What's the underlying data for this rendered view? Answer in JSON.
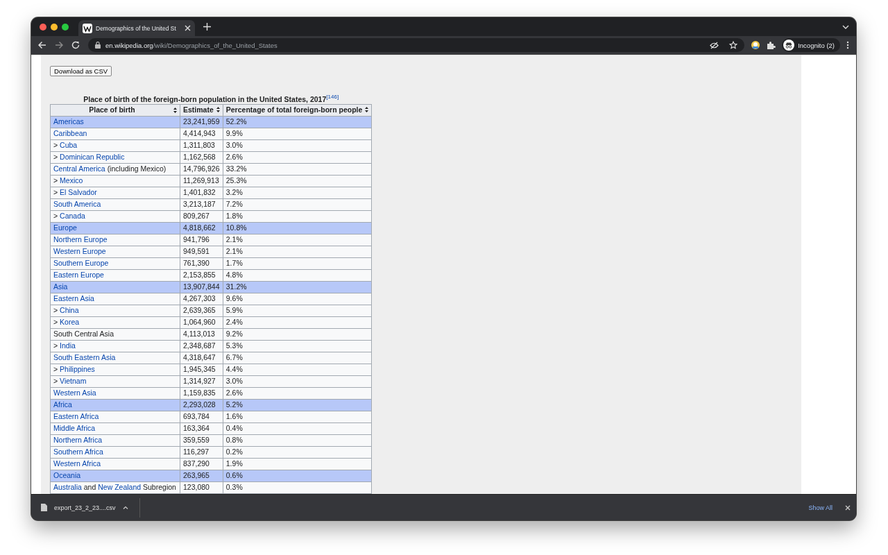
{
  "browser": {
    "tab": {
      "title": "Demographics of the United St",
      "selected": true
    },
    "address": {
      "domain": "en.wikipedia.org",
      "path": "/wiki/Demographics_of_the_United_States"
    },
    "profile": "Incognito (2)"
  },
  "page": {
    "download_button": "Download as CSV",
    "table": {
      "caption": "Place of birth of the foreign-born population in the United States, 2017",
      "caption_ref": "[146]",
      "columns": [
        "Place of birth",
        "Estimate",
        "Percentage of total foreign-born people"
      ],
      "rows": [
        {
          "place": [
            {
              "text": "Americas",
              "link": true
            }
          ],
          "estimate": "23,241,959",
          "percent": "52.2%",
          "highlighted": true
        },
        {
          "place": [
            {
              "text": "Caribbean",
              "link": true
            }
          ],
          "estimate": "4,414,943",
          "percent": "9.9%",
          "highlighted": false
        },
        {
          "place": [
            {
              "text": ">",
              "link": false
            },
            {
              "text": "Cuba",
              "link": true
            }
          ],
          "estimate": "1,311,803",
          "percent": "3.0%",
          "highlighted": false
        },
        {
          "place": [
            {
              "text": ">",
              "link": false
            },
            {
              "text": "Dominican Republic",
              "link": true
            }
          ],
          "estimate": "1,162,568",
          "percent": "2.6%",
          "highlighted": false
        },
        {
          "place": [
            {
              "text": "Central America",
              "link": true
            },
            {
              "text": "(including Mexico)",
              "link": false
            }
          ],
          "estimate": "14,796,926",
          "percent": "33.2%",
          "highlighted": false
        },
        {
          "place": [
            {
              "text": ">",
              "link": false
            },
            {
              "text": "Mexico",
              "link": true
            }
          ],
          "estimate": "11,269,913",
          "percent": "25.3%",
          "highlighted": false
        },
        {
          "place": [
            {
              "text": ">",
              "link": false
            },
            {
              "text": "El Salvador",
              "link": true
            }
          ],
          "estimate": "1,401,832",
          "percent": "3.2%",
          "highlighted": false
        },
        {
          "place": [
            {
              "text": "South America",
              "link": true
            }
          ],
          "estimate": "3,213,187",
          "percent": "7.2%",
          "highlighted": false
        },
        {
          "place": [
            {
              "text": ">",
              "link": false
            },
            {
              "text": "Canada",
              "link": true
            }
          ],
          "estimate": "809,267",
          "percent": "1.8%",
          "highlighted": false
        },
        {
          "place": [
            {
              "text": "Europe",
              "link": true
            }
          ],
          "estimate": "4,818,662",
          "percent": "10.8%",
          "highlighted": true
        },
        {
          "place": [
            {
              "text": "Northern Europe",
              "link": true
            }
          ],
          "estimate": "941,796",
          "percent": "2.1%",
          "highlighted": false
        },
        {
          "place": [
            {
              "text": "Western Europe",
              "link": true
            }
          ],
          "estimate": "949,591",
          "percent": "2.1%",
          "highlighted": false
        },
        {
          "place": [
            {
              "text": "Southern Europe",
              "link": true
            }
          ],
          "estimate": "761,390",
          "percent": "1.7%",
          "highlighted": false
        },
        {
          "place": [
            {
              "text": "Eastern Europe",
              "link": true
            }
          ],
          "estimate": "2,153,855",
          "percent": "4.8%",
          "highlighted": false
        },
        {
          "place": [
            {
              "text": "Asia",
              "link": true
            }
          ],
          "estimate": "13,907,844",
          "percent": "31.2%",
          "highlighted": true
        },
        {
          "place": [
            {
              "text": "Eastern Asia",
              "link": true
            }
          ],
          "estimate": "4,267,303",
          "percent": "9.6%",
          "highlighted": false
        },
        {
          "place": [
            {
              "text": ">",
              "link": false
            },
            {
              "text": "China",
              "link": true
            }
          ],
          "estimate": "2,639,365",
          "percent": "5.9%",
          "highlighted": false
        },
        {
          "place": [
            {
              "text": ">",
              "link": false
            },
            {
              "text": "Korea",
              "link": true
            }
          ],
          "estimate": "1,064,960",
          "percent": "2.4%",
          "highlighted": false
        },
        {
          "place": [
            {
              "text": "South Central Asia",
              "link": false
            }
          ],
          "estimate": "4,113,013",
          "percent": "9.2%",
          "highlighted": false
        },
        {
          "place": [
            {
              "text": ">",
              "link": false
            },
            {
              "text": "India",
              "link": true
            }
          ],
          "estimate": "2,348,687",
          "percent": "5.3%",
          "highlighted": false
        },
        {
          "place": [
            {
              "text": "South Eastern Asia",
              "link": true
            }
          ],
          "estimate": "4,318,647",
          "percent": "6.7%",
          "highlighted": false
        },
        {
          "place": [
            {
              "text": ">",
              "link": false
            },
            {
              "text": "Philippines",
              "link": true
            }
          ],
          "estimate": "1,945,345",
          "percent": "4.4%",
          "highlighted": false
        },
        {
          "place": [
            {
              "text": ">",
              "link": false
            },
            {
              "text": "Vietnam",
              "link": true
            }
          ],
          "estimate": "1,314,927",
          "percent": "3.0%",
          "highlighted": false
        },
        {
          "place": [
            {
              "text": "Western Asia",
              "link": true
            }
          ],
          "estimate": "1,159,835",
          "percent": "2.6%",
          "highlighted": false
        },
        {
          "place": [
            {
              "text": "Africa",
              "link": true
            }
          ],
          "estimate": "2,293,028",
          "percent": "5.2%",
          "highlighted": true
        },
        {
          "place": [
            {
              "text": "Eastern Africa",
              "link": true
            }
          ],
          "estimate": "693,784",
          "percent": "1.6%",
          "highlighted": false
        },
        {
          "place": [
            {
              "text": "Middle Africa",
              "link": true
            }
          ],
          "estimate": "163,364",
          "percent": "0.4%",
          "highlighted": false
        },
        {
          "place": [
            {
              "text": "Northern Africa",
              "link": true
            }
          ],
          "estimate": "359,559",
          "percent": "0.8%",
          "highlighted": false
        },
        {
          "place": [
            {
              "text": "Southern Africa",
              "link": true
            }
          ],
          "estimate": "116,297",
          "percent": "0.2%",
          "highlighted": false
        },
        {
          "place": [
            {
              "text": "Western Africa",
              "link": true
            }
          ],
          "estimate": "837,290",
          "percent": "1.9%",
          "highlighted": false
        },
        {
          "place": [
            {
              "text": "Oceania",
              "link": true
            }
          ],
          "estimate": "263,965",
          "percent": "0.6%",
          "highlighted": true
        },
        {
          "place": [
            {
              "text": "Australia",
              "link": true
            },
            {
              "text": "and",
              "link": false
            },
            {
              "text": "New Zealand",
              "link": true
            },
            {
              "text": "Subregion",
              "link": false
            }
          ],
          "estimate": "123,080",
          "percent": "0.3%",
          "highlighted": false
        }
      ]
    }
  },
  "download_bar": {
    "file": "export_23_2_23....csv",
    "show_all": "Show All"
  }
}
